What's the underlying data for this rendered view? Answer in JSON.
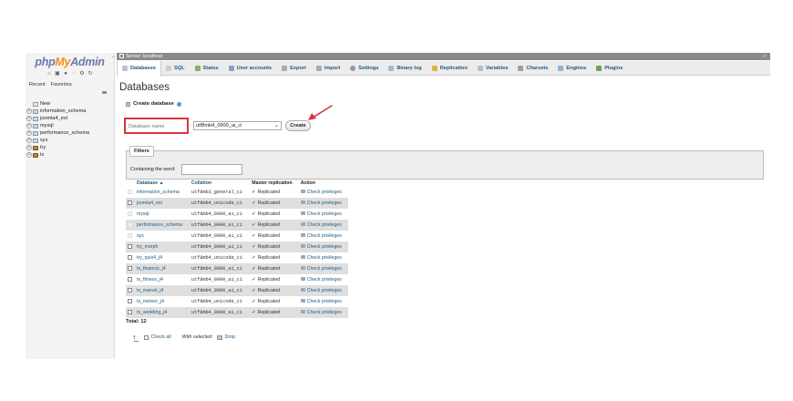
{
  "app": {
    "logo_php": "php",
    "logo_my": "My",
    "logo_admin": "Admin"
  },
  "nav": {
    "tabs": [
      "Recent",
      "Favorites"
    ],
    "tree": [
      {
        "label": "New",
        "icon": "new-db-icon",
        "expandable": false
      },
      {
        "label": "information_schema",
        "icon": "database-icon",
        "expandable": true
      },
      {
        "label": "joomla4_ext",
        "icon": "database-icon",
        "expandable": true
      },
      {
        "label": "mysql",
        "icon": "database-icon",
        "expandable": true
      },
      {
        "label": "performance_schema",
        "icon": "database-icon",
        "expandable": true
      },
      {
        "label": "sys",
        "icon": "database-icon",
        "expandable": true
      },
      {
        "label": "try",
        "icon": "bear-db-icon",
        "expandable": true
      },
      {
        "label": "tx",
        "icon": "bear-db-icon",
        "expandable": true
      }
    ]
  },
  "serverbar": {
    "label": "Server: localhost"
  },
  "tabs": [
    {
      "label": "Databases",
      "icon": "db",
      "active": true
    },
    {
      "label": "SQL",
      "icon": "sql",
      "active": false
    },
    {
      "label": "Status",
      "icon": "status",
      "active": false
    },
    {
      "label": "User accounts",
      "icon": "users",
      "active": false
    },
    {
      "label": "Export",
      "icon": "export",
      "active": false
    },
    {
      "label": "Import",
      "icon": "import",
      "active": false
    },
    {
      "label": "Settings",
      "icon": "settings",
      "active": false
    },
    {
      "label": "Binary log",
      "icon": "binlog",
      "active": false
    },
    {
      "label": "Replication",
      "icon": "repl",
      "active": false
    },
    {
      "label": "Variables",
      "icon": "vars",
      "active": false
    },
    {
      "label": "Charsets",
      "icon": "charsets",
      "active": false
    },
    {
      "label": "Engines",
      "icon": "engines",
      "active": false
    },
    {
      "label": "Plugins",
      "icon": "plugins",
      "active": false
    }
  ],
  "main": {
    "title": "Databases",
    "create_label": "Create database",
    "dbname_placeholder": "Database name",
    "collation_value": "utf8mb4_0900_ai_ci",
    "create_button": "Create",
    "filters_legend": "Filters",
    "filter_label": "Containing the word:",
    "filter_value": "",
    "total": "Total: 12",
    "check_all": "Check all",
    "with_selected": "With selected:",
    "drop": "Drop"
  },
  "table": {
    "headers": {
      "database": "Database",
      "sort_indicator": "▲",
      "collation": "Collation",
      "master_replication": "Master replication",
      "action": "Action"
    },
    "rows": [
      {
        "name": "information_schema",
        "collation": "utf8mb3_general_ci",
        "replication": "Replicated",
        "action": "Check privileges",
        "checkbox_enabled": false
      },
      {
        "name": "joomla4_ext",
        "collation": "utf8mb4_unicode_ci",
        "replication": "Replicated",
        "action": "Check privileges",
        "checkbox_enabled": true
      },
      {
        "name": "mysql",
        "collation": "utf8mb4_0900_ai_ci",
        "replication": "Replicated",
        "action": "Check privileges",
        "checkbox_enabled": false
      },
      {
        "name": "performance_schema",
        "collation": "utf8mb4_0900_ai_ci",
        "replication": "Replicated",
        "action": "Check privileges",
        "checkbox_enabled": false
      },
      {
        "name": "sys",
        "collation": "utf8mb4_0900_ai_ci",
        "replication": "Replicated",
        "action": "Check privileges",
        "checkbox_enabled": false
      },
      {
        "name": "try_morph",
        "collation": "utf8mb4_0900_ai_ci",
        "replication": "Replicated",
        "action": "Check privileges",
        "checkbox_enabled": true
      },
      {
        "name": "try_quix4_j4",
        "collation": "utf8mb4_unicode_ci",
        "replication": "Replicated",
        "action": "Check privileges",
        "checkbox_enabled": true
      },
      {
        "name": "tx_financio_j4",
        "collation": "utf8mb4_0900_ai_ci",
        "replication": "Replicated",
        "action": "Check privileges",
        "checkbox_enabled": true
      },
      {
        "name": "tx_fitness_j4",
        "collation": "utf8mb4_0900_ai_ci",
        "replication": "Replicated",
        "action": "Check privileges",
        "checkbox_enabled": true
      },
      {
        "name": "tx_marvel_j4",
        "collation": "utf8mb4_0900_ai_ci",
        "replication": "Replicated",
        "action": "Check privileges",
        "checkbox_enabled": true
      },
      {
        "name": "tx_meteor_j4",
        "collation": "utf8mb4_unicode_ci",
        "replication": "Replicated",
        "action": "Check privileges",
        "checkbox_enabled": true
      },
      {
        "name": "tx_wedding_j4",
        "collation": "utf8mb4_0900_ai_ci",
        "replication": "Replicated",
        "action": "Check privileges",
        "checkbox_enabled": true
      }
    ]
  },
  "colors": {
    "link": "#235a81",
    "highlight_border": "#d9343a",
    "arrow": "#d9343a",
    "replicated_check": "#3a8a2e"
  }
}
